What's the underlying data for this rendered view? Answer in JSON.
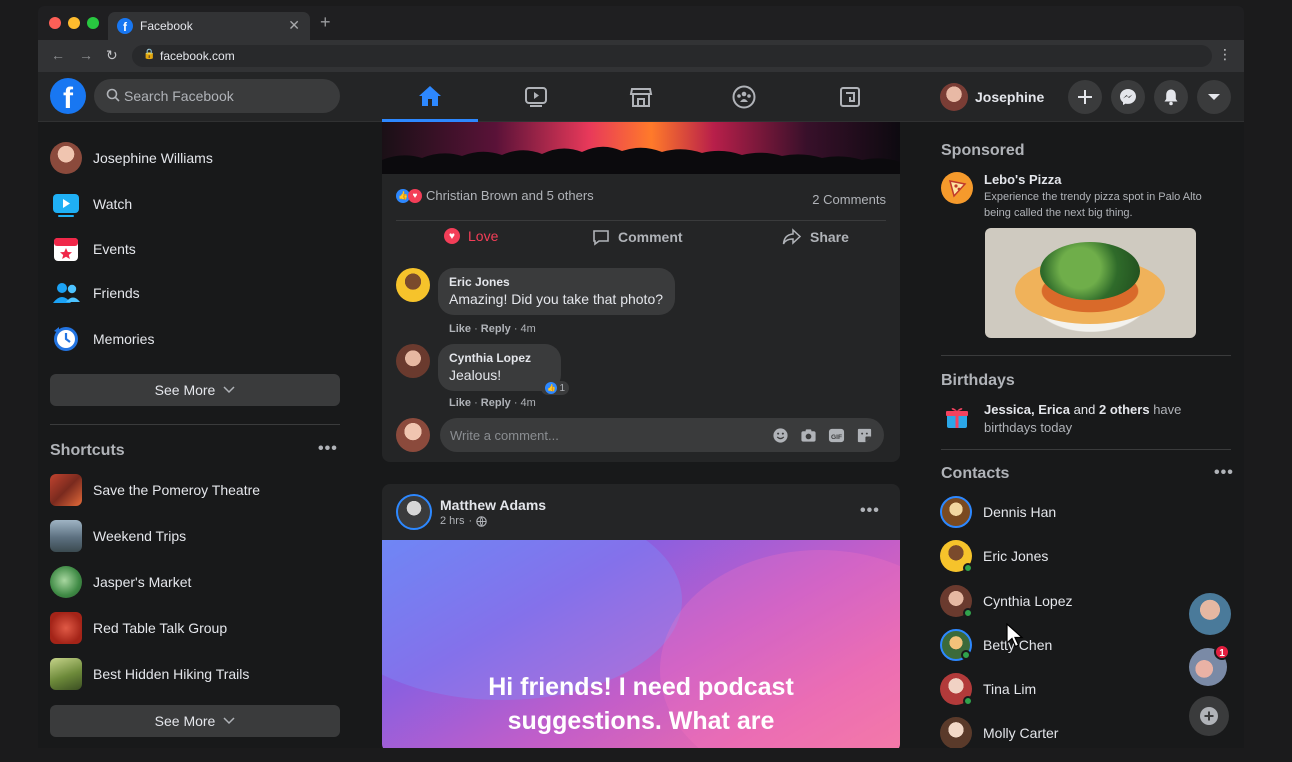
{
  "browser": {
    "tab_title": "Facebook",
    "url": "facebook.com"
  },
  "header": {
    "search_placeholder": "Search Facebook",
    "user_name": "Josephine",
    "nav_tabs": [
      "home",
      "watch",
      "marketplace",
      "groups",
      "gaming"
    ]
  },
  "sidebar": {
    "profile_name": "Josephine Williams",
    "items": [
      {
        "label": "Watch",
        "icon": "watch-icon"
      },
      {
        "label": "Events",
        "icon": "events-icon"
      },
      {
        "label": "Friends",
        "icon": "friends-icon"
      },
      {
        "label": "Memories",
        "icon": "memories-icon"
      }
    ],
    "see_more_label": "See More",
    "shortcuts_title": "Shortcuts",
    "shortcuts": [
      {
        "label": "Save the Pomeroy Theatre"
      },
      {
        "label": "Weekend Trips"
      },
      {
        "label": "Jasper's Market"
      },
      {
        "label": "Red Table Talk Group"
      },
      {
        "label": "Best Hidden Hiking Trails"
      }
    ],
    "shortcuts_see_more_label": "See More"
  },
  "post1": {
    "reactions_text": "Christian Brown and 5 others",
    "comments_count": "2 Comments",
    "love_label": "Love",
    "comment_label": "Comment",
    "share_label": "Share",
    "comments": [
      {
        "author": "Eric Jones",
        "text": "Amazing! Did you take that photo?",
        "time": "4m"
      },
      {
        "author": "Cynthia Lopez",
        "text": "Jealous!",
        "time": "4m",
        "reaction_count": "1"
      }
    ],
    "like_label": "Like",
    "reply_label": "Reply",
    "comment_placeholder": "Write a comment..."
  },
  "post2": {
    "author": "Matthew Adams",
    "time": "2 hrs",
    "text_line1": "Hi friends! I need podcast",
    "text_line2": "suggestions. What are"
  },
  "right": {
    "sponsored_title": "Sponsored",
    "ad_name": "Lebo's Pizza",
    "ad_text": "Experience the trendy pizza spot in Palo Alto being called the next big thing.",
    "birthdays_title": "Birthdays",
    "birthday_names": "Jessica, Erica",
    "birthday_and": "and",
    "birthday_others": "2 others",
    "birthday_rest": "have birthdays today",
    "contacts_title": "Contacts",
    "contacts": [
      {
        "name": "Dennis Han"
      },
      {
        "name": "Eric Jones"
      },
      {
        "name": "Cynthia Lopez"
      },
      {
        "name": "Betty Chen"
      },
      {
        "name": "Tina Lim"
      },
      {
        "name": "Molly Carter"
      }
    ],
    "chat_badge": "1"
  },
  "colors": {
    "accent": "#1877f2",
    "active_tab": "#2d88ff",
    "love": "#f33e58",
    "online": "#31a24c"
  }
}
